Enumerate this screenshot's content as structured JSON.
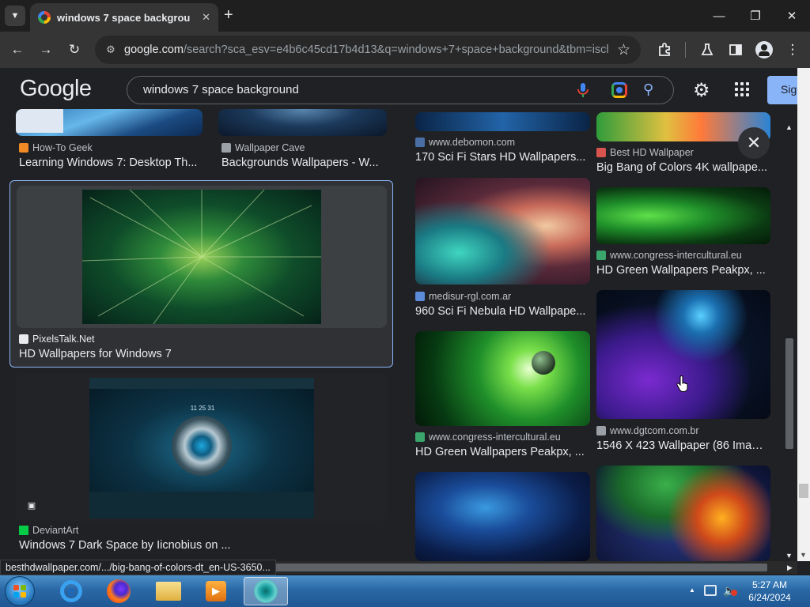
{
  "browser": {
    "tab_title": "windows 7 space background",
    "tab_close": "✕",
    "new_tab": "+",
    "url_host": "google.com",
    "url_path": "/search?sca_esv=e4b6c45cd17b4d13&q=windows+7+space+background&tbm=isch..."
  },
  "google": {
    "logo": "Google",
    "query": "windows 7 space background",
    "signin_label": "Sig"
  },
  "results": {
    "left": [
      {
        "source": "How-To Geek",
        "title": "Learning Windows 7: Desktop Th..."
      },
      {
        "source": "Wallpaper Cave",
        "title": "Backgrounds Wallpapers - W..."
      },
      {
        "source": "PixelsTalk.Net",
        "title": "HD Wallpapers for Windows 7"
      },
      {
        "source": "DeviantArt",
        "title": "Windows 7 Dark Space by Iicnobius on ..."
      }
    ],
    "right": [
      {
        "source": "www.debomon.com",
        "title": "170 Sci Fi Stars HD Wallpapers..."
      },
      {
        "source": "Best HD Wallpaper",
        "title": "Big Bang of Colors 4K wallpape..."
      },
      {
        "source": "www.congress-intercultural.eu",
        "title": "HD Green Wallpapers Peakpx, ..."
      },
      {
        "source": "medisur-rgl.com.ar",
        "title": "960 Sci Fi Nebula HD Wallpape..."
      },
      {
        "source": "www.congress-intercultural.eu",
        "title": "HD Green Wallpapers Peakpx, ..."
      },
      {
        "source": "www.dgtcom.com.br",
        "title": "1546 X 423 Wallpaper (86 Imag..."
      }
    ],
    "thumb_clock": "11 25 31"
  },
  "status_url": "besthdwallpaper.com/.../big-bang-of-colors-dt_en-US-3650...",
  "taskbar": {
    "time": "5:27 AM",
    "date": "6/24/2024"
  },
  "colors": {
    "accent": "#8ab4f8",
    "background": "#202124"
  }
}
